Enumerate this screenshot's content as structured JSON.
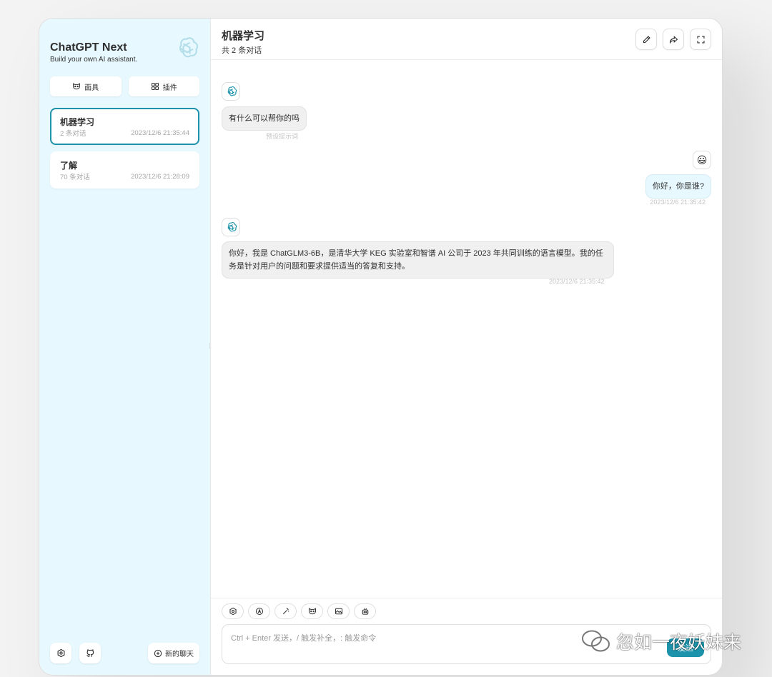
{
  "sidebar": {
    "title": "ChatGPT Next",
    "subtitle": "Build your own AI assistant.",
    "mask_label": "面具",
    "plugin_label": "插件",
    "chats": [
      {
        "title": "机器学习",
        "count": "2 条对话",
        "date": "2023/12/6 21:35:44",
        "selected": true
      },
      {
        "title": "了解",
        "count": "70 条对话",
        "date": "2023/12/6 21:28:09",
        "selected": false
      }
    ],
    "new_chat_label": "新的聊天",
    "icons": [
      "openai-logo-icon",
      "mask-icon",
      "plugin-grid-icon",
      "settings-icon",
      "github-icon",
      "add-circle-icon"
    ]
  },
  "header": {
    "title": "机器学习",
    "subtitle": "共 2 条对话",
    "icons": [
      "edit-icon",
      "share-icon",
      "fullscreen-icon"
    ]
  },
  "messages": [
    {
      "role": "bot",
      "text": "有什么可以帮你的吗",
      "meta": "预设提示词"
    },
    {
      "role": "user",
      "avatar": "😃",
      "text": "你好，你是谁?",
      "meta": "2023/12/6 21:35:42"
    },
    {
      "role": "bot",
      "text": "你好，我是 ChatGLM3-6B，是清华大学 KEG 实验室和智谱 AI 公司于 2023 年共同训练的语言模型。我的任务是针对用户的问题和要求提供适当的答复和支持。",
      "meta": "2023/12/6 21:35:42"
    }
  ],
  "input": {
    "placeholder": "Ctrl + Enter 发送，/ 触发补全，: 触发命令",
    "send_label": "发送",
    "tools": [
      "settings-tool-icon",
      "theme-auto-icon",
      "prompt-magic-icon",
      "mask-tool-icon",
      "image-tool-icon",
      "robot-tool-icon"
    ]
  },
  "watermark": {
    "text": "忽如一夜妖妹来"
  },
  "colors": {
    "accent": "#1d93ab",
    "sidebar_bg": "#e7f8ff",
    "bot_bubble": "#f0f0f0",
    "user_bubble": "#e7f8ff"
  }
}
